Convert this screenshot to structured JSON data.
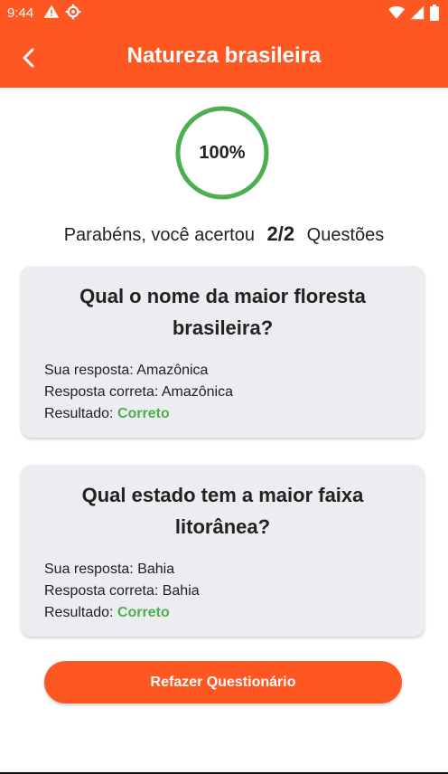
{
  "status_bar": {
    "time": "9:44",
    "icons_left": [
      "warning-icon",
      "settings-icon"
    ],
    "icons_right": [
      "wifi-icon",
      "signal-icon",
      "battery-icon"
    ]
  },
  "app_bar": {
    "title": "Natureza brasileira",
    "back_icon": "back-arrow-icon"
  },
  "progress": {
    "percent_label": "100%",
    "fraction": 1.0,
    "color": "#4caf50"
  },
  "summary": {
    "prefix": "Parabéns, você acertou",
    "score": "2/2",
    "suffix": "Questões"
  },
  "questions": [
    {
      "question": "Qual o nome da maior floresta brasileira?",
      "your_answer_label": "Sua resposta:",
      "your_answer": "Amazônica",
      "correct_answer_label": "Resposta correta:",
      "correct_answer": "Amazônica",
      "result_label": "Resultado:",
      "result": "Correto"
    },
    {
      "question": "Qual estado tem a maior faixa litorânea?",
      "your_answer_label": "Sua resposta:",
      "your_answer": "Bahia",
      "correct_answer_label": "Resposta correta:",
      "correct_answer": "Bahia",
      "result_label": "Resultado:",
      "result": "Correto"
    }
  ],
  "redo_button": {
    "label": "Refazer Questionário"
  },
  "colors": {
    "accent": "#ff5722",
    "success": "#4caf50",
    "card_bg": "#ecedf0"
  }
}
